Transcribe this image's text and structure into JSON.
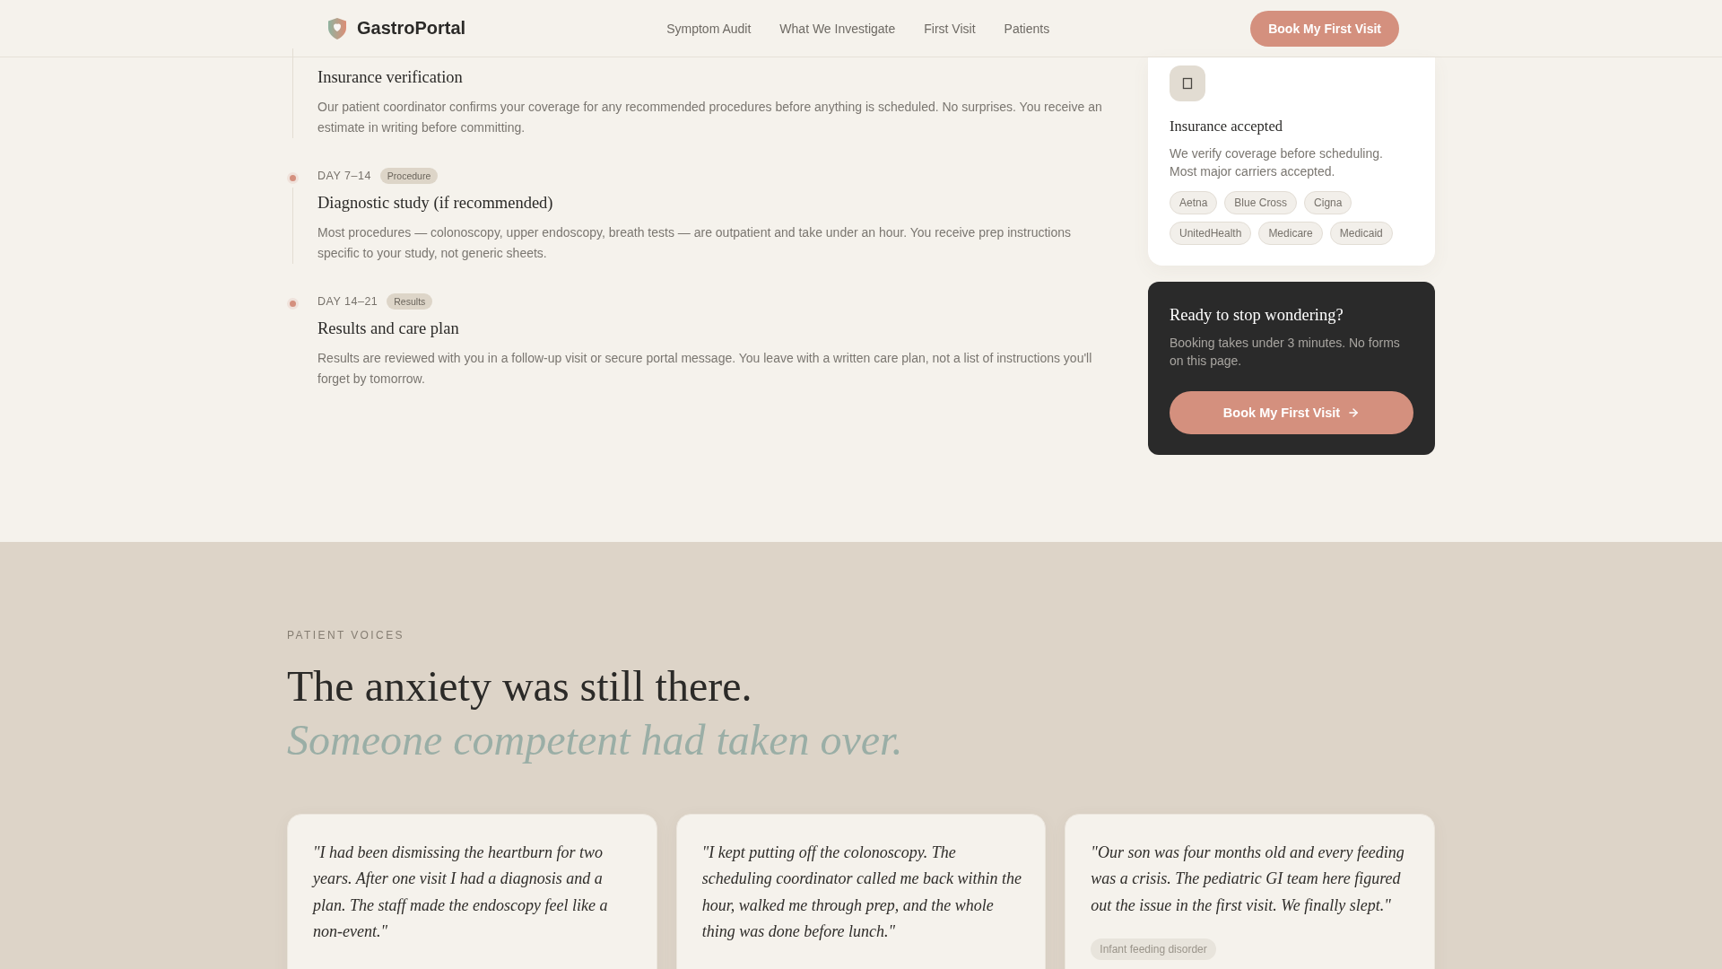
{
  "header": {
    "brand": "GastroPortal",
    "nav": [
      {
        "label": "Symptom Audit"
      },
      {
        "label": "What We Investigate"
      },
      {
        "label": "First Visit"
      },
      {
        "label": "Patients"
      }
    ],
    "cta": "Book My First Visit"
  },
  "timeline": [
    {
      "title": "Insurance verification",
      "description": "Our patient coordinator confirms your coverage for any recommended procedures before anything is scheduled. No surprises. You receive an estimate in writing before committing."
    },
    {
      "day": "DAY 7–14",
      "badge": "Procedure",
      "title": "Diagnostic study (if recommended)",
      "description": "Most procedures — colonoscopy, upper endoscopy, breath tests — are outpatient and take under an hour. You receive prep instructions specific to your study, not generic sheets."
    },
    {
      "day": "DAY 14–21",
      "badge": "Results",
      "title": "Results and care plan",
      "description": "Results are reviewed with you in a follow-up visit or secure portal message. You leave with a written care plan, not a list of instructions you'll forget by tomorrow."
    }
  ],
  "insurance_card": {
    "title": "Insurance accepted",
    "description": "We verify coverage before scheduling. Most major carriers accepted.",
    "carriers": [
      "Aetna",
      "Blue Cross",
      "Cigna",
      "UnitedHealth",
      "Medicare",
      "Medicaid"
    ]
  },
  "booking_card": {
    "title": "Ready to stop wondering?",
    "description": "Booking takes under 3 minutes. No forms on this page.",
    "button": "Book My First Visit"
  },
  "testimonials": {
    "eyebrow": "PATIENT VOICES",
    "heading": "The anxiety was still there.",
    "heading_accent": "Someone competent had taken over.",
    "quotes": [
      {
        "text": "\"I had been dismissing the heartburn for two years. After one visit I had a diagnosis and a plan. The staff made the endoscopy feel like a non-event.\""
      },
      {
        "text": "\"I kept putting off the colonoscopy. The scheduling coordinator called me back within the hour, walked me through prep, and the whole thing was done before lunch.\""
      },
      {
        "text": "\"Our son was four months old and every feeding was a crisis. The pediatric GI team here figured out the issue in the first visit. We finally slept.\"",
        "tag": "Infant feeding disorder"
      }
    ]
  }
}
